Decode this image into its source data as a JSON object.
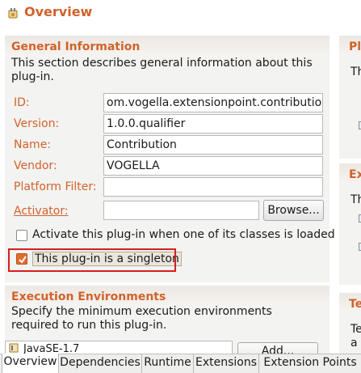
{
  "header": {
    "title": "Overview",
    "icon": "plugin-icon"
  },
  "general": {
    "title": "General Information",
    "description": "This section describes general information about this plug-in.",
    "fields": {
      "id": {
        "label": "ID:",
        "value": "om.vogella.extensionpoint.contribution"
      },
      "version": {
        "label": "Version:",
        "value": "1.0.0.qualifier"
      },
      "name": {
        "label": "Name:",
        "value": "Contribution"
      },
      "vendor": {
        "label": "Vendor:",
        "value": "VOGELLA"
      },
      "platform_filter": {
        "label": "Platform Filter:",
        "value": ""
      },
      "activator": {
        "label": "Activator:",
        "value": ""
      }
    },
    "browse_label": "Browse...",
    "activate_check": {
      "label": "Activate this plug-in when one of its classes is loaded",
      "checked": false
    },
    "singleton_check": {
      "label": "This plug-in is a singleton",
      "checked": true
    }
  },
  "execution": {
    "title": "Execution Environments",
    "description": "Specify the minimum execution environments required to run this plug-in.",
    "environments": [
      "JavaSE-1.7"
    ],
    "add_label": "Add..."
  },
  "right_sections": [
    {
      "title": "Pl",
      "text": "Th"
    },
    {
      "title": "Ex",
      "text": "Th"
    },
    {
      "title": "Te",
      "text": "Te",
      "text2": "a"
    }
  ],
  "tabs": [
    "Overview",
    "Dependencies",
    "Runtime",
    "Extensions",
    "Extension Points"
  ],
  "active_tab": "Overview",
  "colors": {
    "accent": "#d2622a",
    "highlight": "#d61e1e",
    "checked": "#e36d2b"
  }
}
